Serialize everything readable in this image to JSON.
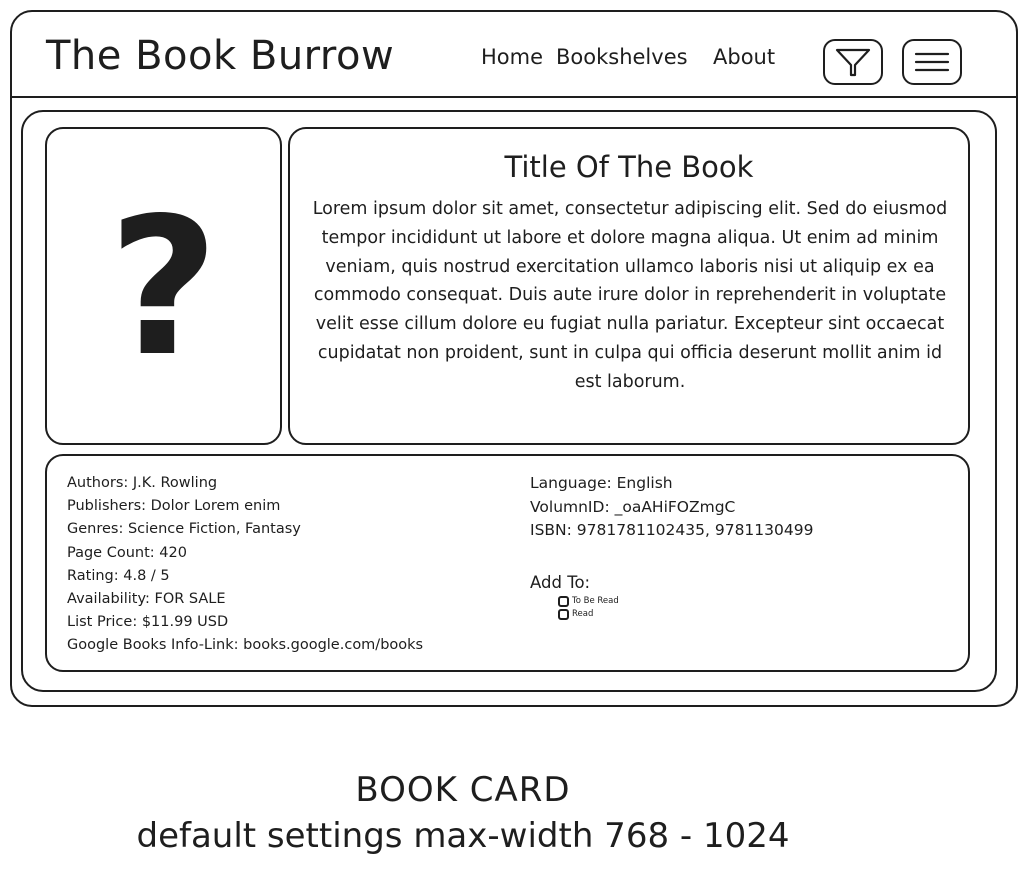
{
  "header": {
    "site_title": "The Book Burrow",
    "nav": [
      "Home",
      "Bookshelves",
      "About"
    ],
    "icons": [
      "filter-icon",
      "hamburger-menu-icon"
    ]
  },
  "book": {
    "cover_placeholder": "?",
    "title": "Title Of The Book",
    "description": "Lorem ipsum dolor sit amet, consectetur adipiscing elit. Sed do eiusmod tempor incididunt ut labore et dolore magna aliqua. Ut enim ad minim veniam, quis nostrud exercitation ullamco laboris nisi ut aliquip ex ea commodo consequat. Duis aute irure dolor in reprehenderit in voluptate velit esse cillum dolore eu fugiat nulla pariatur. Excepteur sint occaecat cupidatat non proident, sunt in culpa qui officia deserunt mollit anim id est laborum.",
    "details_left": [
      "Authors: J.K. Rowling",
      "Publishers: Dolor Lorem enim",
      "Genres: Science Fiction, Fantasy",
      "Page Count: 420",
      "Rating: 4.8 / 5",
      "Availability: FOR SALE",
      "List Price: $11.99 USD",
      "Google Books Info-Link: books.google.com/books"
    ],
    "details_right": [
      "Language: English",
      "VolumnID: _oaAHiFOZmgC",
      "ISBN: 9781781102435, 9781130499"
    ],
    "add_to": {
      "label": "Add To:",
      "options": [
        "To Be Read",
        "Read"
      ]
    }
  },
  "captions": {
    "line1": "BOOK CARD",
    "line2": "default settings max-width 768 - 1024"
  }
}
